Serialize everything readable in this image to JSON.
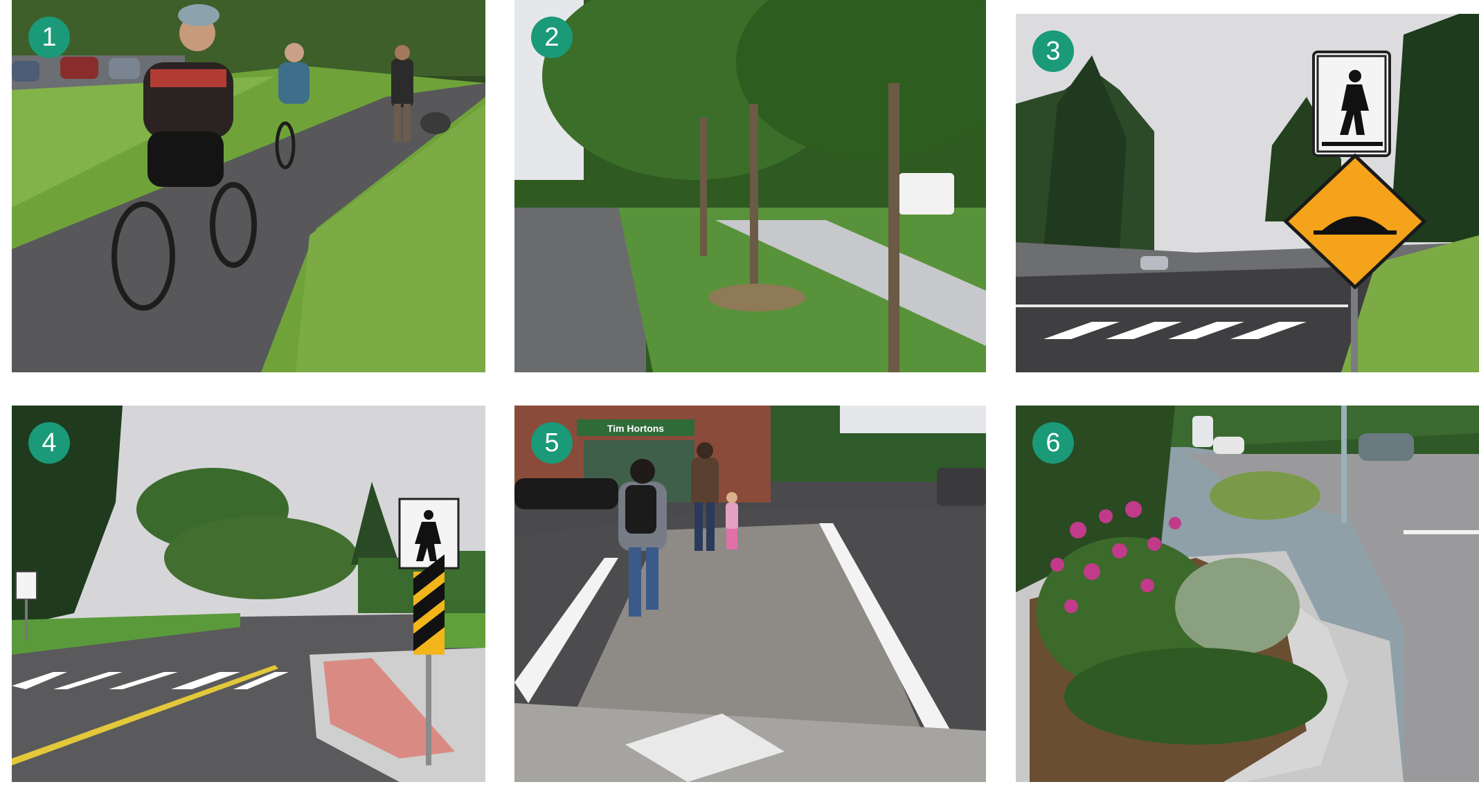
{
  "panels": [
    {
      "number": "1"
    },
    {
      "number": "2"
    },
    {
      "number": "3"
    },
    {
      "number": "4"
    },
    {
      "number": "5"
    },
    {
      "number": "6"
    }
  ],
  "colors": {
    "badge": "#1a9a78",
    "grass": "#6fa33a",
    "asphalt": "#58585a",
    "sky": "#dcdcdf",
    "warning_sign": "#f5a31a"
  },
  "storefront_sign": "Tim Hortons"
}
